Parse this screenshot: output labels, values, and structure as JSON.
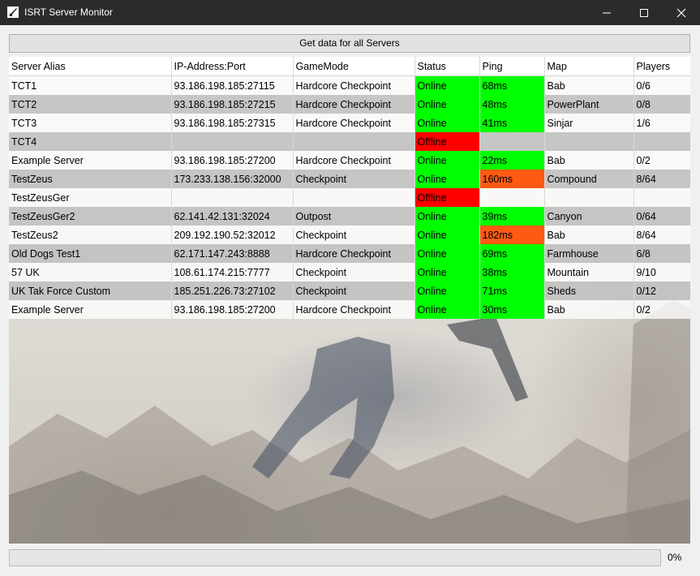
{
  "window": {
    "title": "ISRT Server Monitor",
    "icon": "isrt-app-icon",
    "controls": [
      "minimize-icon",
      "maximize-icon",
      "close-icon"
    ]
  },
  "toolbar": {
    "get_all_label": "Get data for all Servers"
  },
  "table": {
    "columns": [
      "Server Alias",
      "IP-Address:Port",
      "GameMode",
      "Status",
      "Ping",
      "Map",
      "Players"
    ],
    "rows": [
      {
        "alias": "TCT1",
        "ip": "93.186.198.185:27115",
        "mode": "Hardcore Checkpoint",
        "status": "Online",
        "ping": "68ms",
        "ping_level": "good",
        "map": "Bab",
        "players": "0/6"
      },
      {
        "alias": "TCT2",
        "ip": "93.186.198.185:27215",
        "mode": "Hardcore Checkpoint",
        "status": "Online",
        "ping": "48ms",
        "ping_level": "good",
        "map": "PowerPlant",
        "players": "0/8"
      },
      {
        "alias": "TCT3",
        "ip": "93.186.198.185:27315",
        "mode": "Hardcore Checkpoint",
        "status": "Online",
        "ping": "41ms",
        "ping_level": "good",
        "map": "Sinjar",
        "players": "1/6"
      },
      {
        "alias": "TCT4",
        "ip": "",
        "mode": "",
        "status": "Offline",
        "ping": "",
        "ping_level": "none",
        "map": "",
        "players": ""
      },
      {
        "alias": "Example Server",
        "ip": "93.186.198.185:27200",
        "mode": "Hardcore Checkpoint",
        "status": "Online",
        "ping": "22ms",
        "ping_level": "good",
        "map": "Bab",
        "players": "0/2"
      },
      {
        "alias": "TestZeus",
        "ip": "173.233.138.156:32000",
        "mode": "Checkpoint",
        "status": "Online",
        "ping": "160ms",
        "ping_level": "bad",
        "map": "Compound",
        "players": "8/64"
      },
      {
        "alias": "TestZeusGer",
        "ip": "",
        "mode": "",
        "status": "Offline",
        "ping": "",
        "ping_level": "none",
        "map": "",
        "players": ""
      },
      {
        "alias": "TestZeusGer2",
        "ip": "62.141.42.131:32024",
        "mode": "Outpost",
        "status": "Online",
        "ping": "39ms",
        "ping_level": "good",
        "map": "Canyon",
        "players": "0/64"
      },
      {
        "alias": "TestZeus2",
        "ip": "209.192.190.52:32012",
        "mode": "Checkpoint",
        "status": "Online",
        "ping": "182ms",
        "ping_level": "bad",
        "map": "Bab",
        "players": "8/64"
      },
      {
        "alias": "Old Dogs Test1",
        "ip": "62.171.147.243:8888",
        "mode": "Hardcore Checkpoint",
        "status": "Online",
        "ping": "69ms",
        "ping_level": "good",
        "map": "Farmhouse",
        "players": "6/8"
      },
      {
        "alias": "57 UK",
        "ip": "108.61.174.215:7777",
        "mode": "Checkpoint",
        "status": "Online",
        "ping": "38ms",
        "ping_level": "good",
        "map": "Mountain",
        "players": "9/10"
      },
      {
        "alias": "UK Tak Force Custom",
        "ip": "185.251.226.73:27102",
        "mode": "Checkpoint",
        "status": "Online",
        "ping": "71ms",
        "ping_level": "good",
        "map": "Sheds",
        "players": "0/12"
      },
      {
        "alias": "Example Server",
        "ip": "93.186.198.185:27200",
        "mode": "Hardcore Checkpoint",
        "status": "Online",
        "ping": "30ms",
        "ping_level": "good",
        "map": "Bab",
        "players": "0/2"
      }
    ]
  },
  "progress": {
    "fraction": 0,
    "label": "0%"
  },
  "colors": {
    "online": "#00ff00",
    "offline": "#ff0000",
    "ping_good": "#00ff00",
    "ping_bad": "#ff5a12",
    "titlebar": "#2b2b2b"
  }
}
